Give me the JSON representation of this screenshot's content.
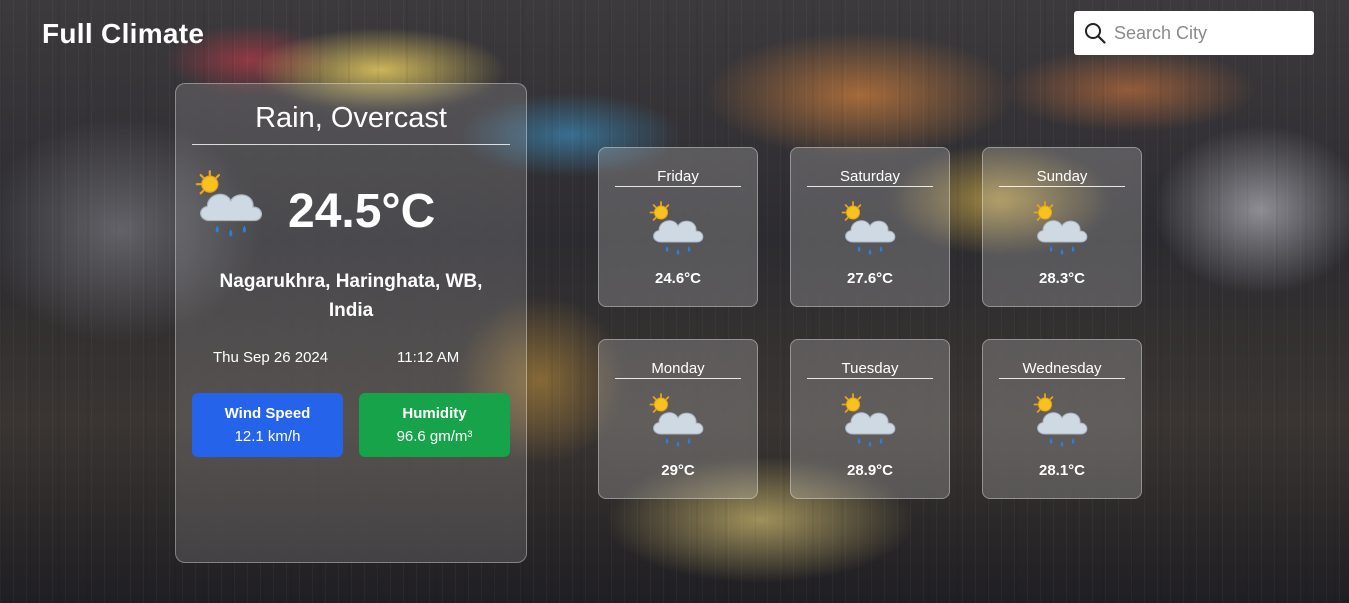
{
  "app": {
    "title": "Full Climate"
  },
  "search": {
    "placeholder": "Search City",
    "icon": "search-icon"
  },
  "current": {
    "condition": "Rain, Overcast",
    "icon": "rain-cloud-sun-icon",
    "temperature": "24.5°C",
    "location": "Nagarukhra, Haringhata, WB, India",
    "date": "Thu Sep 26 2024",
    "time": "11:12 AM",
    "wind": {
      "label": "Wind Speed",
      "value": "12.1 km/h",
      "color": "#2563eb"
    },
    "humidity": {
      "label": "Humidity",
      "value": "96.6 gm/m³",
      "color": "#16a34a"
    }
  },
  "forecast": [
    {
      "day": "Friday",
      "temp": "24.6°C",
      "icon": "rain-cloud-sun-icon"
    },
    {
      "day": "Saturday",
      "temp": "27.6°C",
      "icon": "rain-cloud-sun-icon"
    },
    {
      "day": "Sunday",
      "temp": "28.3°C",
      "icon": "rain-cloud-sun-icon"
    },
    {
      "day": "Monday",
      "temp": "29°C",
      "icon": "rain-cloud-sun-icon"
    },
    {
      "day": "Tuesday",
      "temp": "28.9°C",
      "icon": "rain-cloud-sun-icon"
    },
    {
      "day": "Wednesday",
      "temp": "28.1°C",
      "icon": "rain-cloud-sun-icon"
    }
  ]
}
